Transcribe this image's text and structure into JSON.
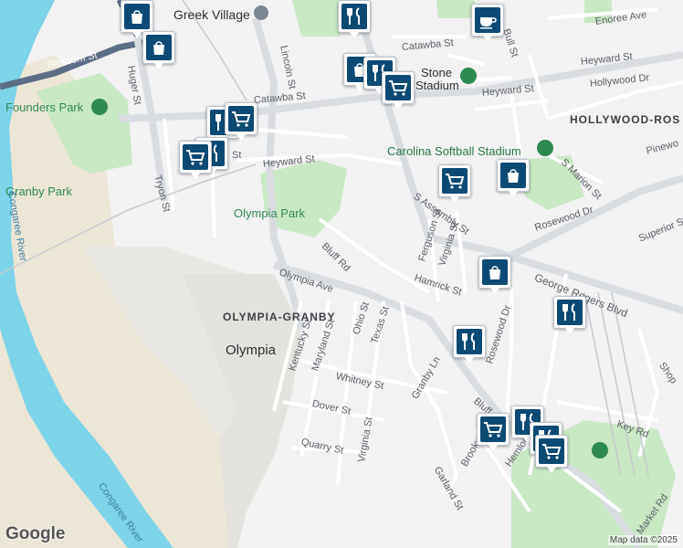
{
  "map": {
    "attribution": "Map data ©2025",
    "logo": "Google",
    "colors": {
      "land": "#f2f2f3",
      "water": "#7dd3e8",
      "park": "#c9e8c4",
      "sand": "#ece6d6",
      "road": "#ffffff",
      "highway": "#d9dde2",
      "highway_dark": "#5b6e86",
      "pin": "#0d4a73",
      "poi_green": "#2f8a50"
    },
    "labels": {
      "greek_village": "Greek Village",
      "blossom": "Blossom St",
      "huger": "Huger St",
      "founders_park": "Founders Park",
      "granby_park": "Granby Park",
      "tryon": "Tryon St",
      "congaree_1": "Congaree River",
      "congaree_2": "Congaree River",
      "lincoln": "Lincoln St",
      "catawba_1": "Catawba St",
      "catawba_2": "Catawba St",
      "st_short": "St",
      "heyward_1": "Heyward St",
      "heyward_2": "Heyward St",
      "heyward_3": "Heyward St",
      "olympia_park": "Olympia Park",
      "bluff_rd": "Bluff Rd",
      "bluff_rd_2": "Bluff",
      "olympia_ave": "Olympia Ave",
      "olympia_granby": "OLYMPIA-GRANBY",
      "olympia": "Olympia",
      "kentucky": "Kentucky St",
      "maryland": "Maryland St",
      "ohio": "Ohio St",
      "texas": "Texas St",
      "whitney": "Whitney St",
      "dover": "Dover St",
      "quarry": "Quarry St",
      "virginia_1": "Virginia St",
      "virginia_2": "Virginia St",
      "granby_ln": "Granby Ln",
      "stone_stadium": "Stone",
      "stone_stadium_2": "Stadium",
      "softball": "Carolina Softball Stadium",
      "s_marion": "S Marion St",
      "s_assembly": "S Assembly St",
      "ferguson": "Ferguson St",
      "hamrick": "Hamrick St",
      "rosewood_dr": "Rosewood Dr",
      "rosewood_dr_2": "Rosewood Dr",
      "george_rogers": "George Rogers Blvd",
      "superior": "Superior St",
      "hollywood_rose": "HOLLYWOOD-ROS",
      "hollywood_dr": "Hollywood Dr",
      "enoree": "Enoree Ave",
      "bull": "Bull St",
      "pinewood": "Pinewo",
      "shop": "Shop",
      "key_rd": "Key Rd",
      "hemlock": "Hemlock Rd",
      "brookwood": "Brookwo",
      "garland": "Garland St",
      "market": "Market Rd"
    },
    "markers": [
      {
        "id": "m1",
        "icon": "shopping-bag-icon"
      },
      {
        "id": "m2",
        "icon": "shopping-bag-icon"
      },
      {
        "id": "m3",
        "icon": "restaurant-icon"
      },
      {
        "id": "m4",
        "icon": "coffee-icon"
      },
      {
        "id": "m5",
        "icon": "shopping-bag-icon"
      },
      {
        "id": "m6",
        "icon": "restaurant-icon"
      },
      {
        "id": "m7",
        "icon": "grocery-cart-icon"
      },
      {
        "id": "m8",
        "icon": "restaurant-icon"
      },
      {
        "id": "m9",
        "icon": "grocery-cart-icon"
      },
      {
        "id": "m10",
        "icon": "restaurant-icon"
      },
      {
        "id": "m11",
        "icon": "grocery-cart-icon"
      },
      {
        "id": "m12",
        "icon": "grocery-cart-icon"
      },
      {
        "id": "m13",
        "icon": "shopping-bag-icon"
      },
      {
        "id": "m14",
        "icon": "shopping-bag-icon"
      },
      {
        "id": "m15",
        "icon": "restaurant-icon"
      },
      {
        "id": "m16",
        "icon": "restaurant-icon"
      },
      {
        "id": "m17",
        "icon": "grocery-cart-icon"
      },
      {
        "id": "m18",
        "icon": "restaurant-icon"
      },
      {
        "id": "m19",
        "icon": "restaurant-icon"
      },
      {
        "id": "m20",
        "icon": "grocery-cart-icon"
      }
    ]
  }
}
